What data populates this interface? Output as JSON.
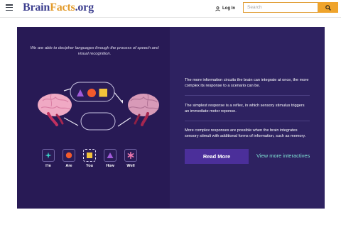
{
  "header": {
    "logo": {
      "part1": "Brain",
      "part2": "Facts",
      "part3": ".org"
    },
    "login_label": "Log In",
    "search": {
      "placeholder": "Search",
      "value": ""
    }
  },
  "colors": {
    "panel": "#2c1f5c",
    "accent_orange": "#efa42c",
    "button_purple": "#4b2f9a",
    "link_teal": "#7fe3d4",
    "brain_pink": "#f0a9c4"
  },
  "icons": {
    "menu": "hamburger-icon",
    "login": "user-icon",
    "search": "magnifier-icon"
  },
  "interactive": {
    "caption": "We are able to decipher languages through the process of speech and visual recognition.",
    "keys": [
      {
        "label": "I'm",
        "shape": "star",
        "color": "#3bd2c8"
      },
      {
        "label": "Are",
        "shape": "circle",
        "color": "#f25a2c"
      },
      {
        "label": "You",
        "shape": "square",
        "color": "#f2c23a"
      },
      {
        "label": "How",
        "shape": "triangle",
        "color": "#a05ad8"
      },
      {
        "label": "Well",
        "shape": "asterisk",
        "color": "#f07ab0"
      }
    ],
    "info": [
      "The more information circuits the brain can integrate at once, the more complex its response to a scenario can be.",
      "The simplest response is a reflex, in which sensory stimulus triggers an immediate motor reponse.",
      "More complex responses are possible when the brain integrates sensory stimuli with additional forms of information, such as memory."
    ],
    "read_more_label": "Read More",
    "view_more_label": "View more interactives"
  }
}
